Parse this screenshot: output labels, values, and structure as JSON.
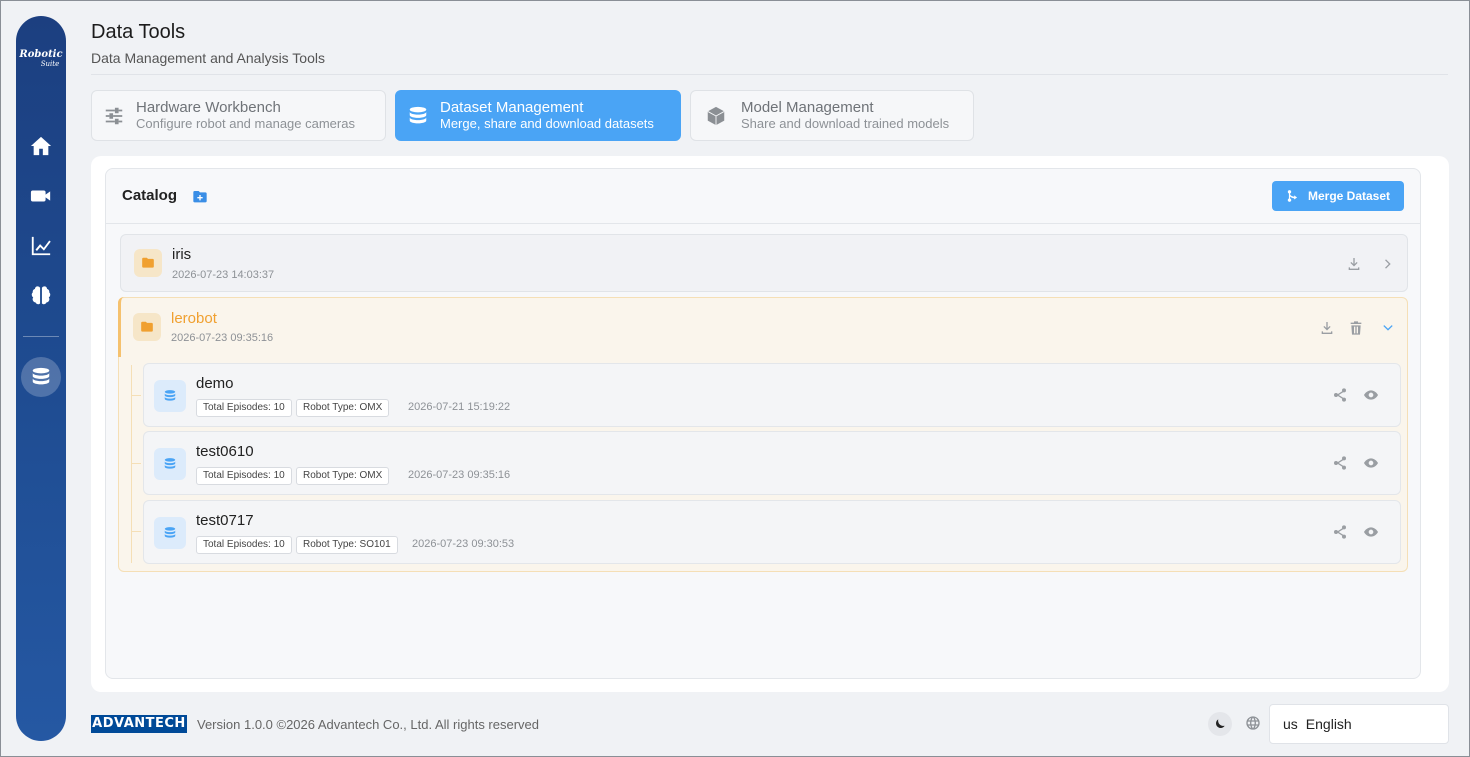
{
  "sidebar": {
    "logo_main": "Robotic",
    "logo_sub": "Suite",
    "items": [
      {
        "icon": "home-icon"
      },
      {
        "icon": "camera-icon"
      },
      {
        "icon": "chart-icon"
      },
      {
        "icon": "brain-icon"
      },
      {
        "icon": "database-icon",
        "active": true
      }
    ]
  },
  "header": {
    "title": "Data Tools",
    "subtitle": "Data Management and Analysis Tools"
  },
  "tabs": [
    {
      "title": "Hardware Workbench",
      "desc": "Configure robot and manage cameras",
      "icon": "sliders-icon",
      "active": false
    },
    {
      "title": "Dataset Management",
      "desc": "Merge, share and download datasets",
      "icon": "database-icon",
      "active": true
    },
    {
      "title": "Model Management",
      "desc": "Share and download trained models",
      "icon": "cube-icon",
      "active": false
    }
  ],
  "catalog": {
    "title": "Catalog",
    "merge_label": "Merge Dataset",
    "folders": [
      {
        "name": "iris",
        "date": "2026-07-23 14:03:37",
        "expanded": false
      },
      {
        "name": "lerobot",
        "date": "2026-07-23 09:35:16",
        "expanded": true,
        "datasets": [
          {
            "name": "demo",
            "episodes": "Total Episodes: 10",
            "robot": "Robot Type: OMX",
            "date": "2026-07-21 15:19:22"
          },
          {
            "name": "test0610",
            "episodes": "Total Episodes: 10",
            "robot": "Robot Type: OMX",
            "date": "2026-07-23 09:35:16"
          },
          {
            "name": "test0717",
            "episodes": "Total Episodes: 10",
            "robot": "Robot Type: SO101",
            "date": "2026-07-23 09:30:53"
          }
        ]
      }
    ]
  },
  "footer": {
    "brand": "ADVANTECH",
    "version_text": "Version 1.0.0 ©2026 Advantech Co., Ltd. All rights reserved",
    "language_flag": "us",
    "language": "English"
  },
  "colors": {
    "accent": "#4aa4f5",
    "sidebar": "#1f4d93",
    "folder": "#f0a030"
  }
}
